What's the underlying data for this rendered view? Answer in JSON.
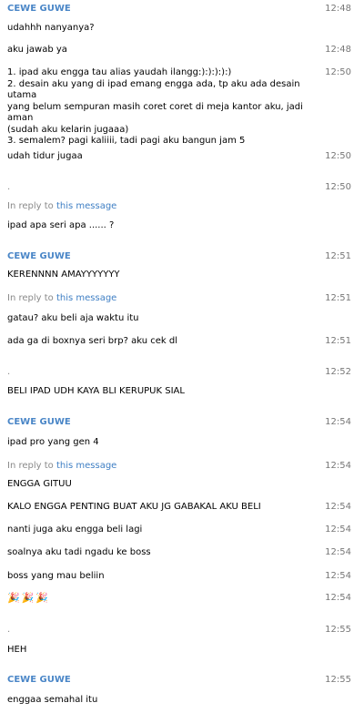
{
  "messages": [
    {
      "name": "CEWE GUWE",
      "time": "12:48",
      "text": "udahhh nanyanya?"
    },
    {
      "text": "aku jawab ya",
      "time": "12:48"
    },
    {
      "lines": [
        "1. ipad aku engga tau alias yaudah ilangg:):):):):)",
        "2. desain aku yang di ipad emang engga ada, tp aku ada desain utama",
        "yang belum sempuran masih coret coret di meja kantor aku, jadi aman",
        "(sudah aku kelarin jugaaa)",
        "3. semalem? pagi kaliiii, tadi pagi aku bangun jam 5"
      ],
      "time": "12:50"
    },
    {
      "text": "udah tidur jugaa",
      "time": "12:50"
    },
    {
      "name": ".",
      "time": "12:50",
      "reply_prefix": "In reply to",
      "reply_link": "this message",
      "text": "ipad apa seri apa ...... ?"
    },
    {
      "name": "CEWE GUWE",
      "time": "12:51",
      "text": "KERENNNN AMAYYYYYYY"
    },
    {
      "reply_prefix": "In reply to",
      "reply_link": "this message",
      "time": "12:51",
      "text": "gatau? aku beli aja waktu itu"
    },
    {
      "text": "ada ga di boxnya seri brp? aku cek dl",
      "time": "12:51"
    },
    {
      "name": ".",
      "time": "12:52",
      "text": "BELI IPAD UDH KAYA BLI KERUPUK SIAL"
    },
    {
      "name": "CEWE GUWE",
      "time": "12:54",
      "text": "ipad pro yang gen 4"
    },
    {
      "reply_prefix": "In reply to",
      "reply_link": "this message",
      "time": "12:54",
      "text": "ENGGA GITUU"
    },
    {
      "text": "KALO ENGGA PENTING BUAT AKU JG GABAKAL AKU BELI",
      "time": "12:54"
    },
    {
      "text": "nanti juga aku engga beli lagi",
      "time": "12:54"
    },
    {
      "text": "soalnya aku tadi ngadu ke boss",
      "time": "12:54"
    },
    {
      "text": "boss yang mau beliin",
      "time": "12:54"
    },
    {
      "emojis": [
        "🎉",
        "🎉",
        "🎉"
      ],
      "time": "12:54"
    },
    {
      "name": ".",
      "time": "12:55",
      "text": "HEH"
    },
    {
      "name": "CEWE GUWE",
      "time": "12:55",
      "text": "enggaa semahal itu"
    }
  ]
}
